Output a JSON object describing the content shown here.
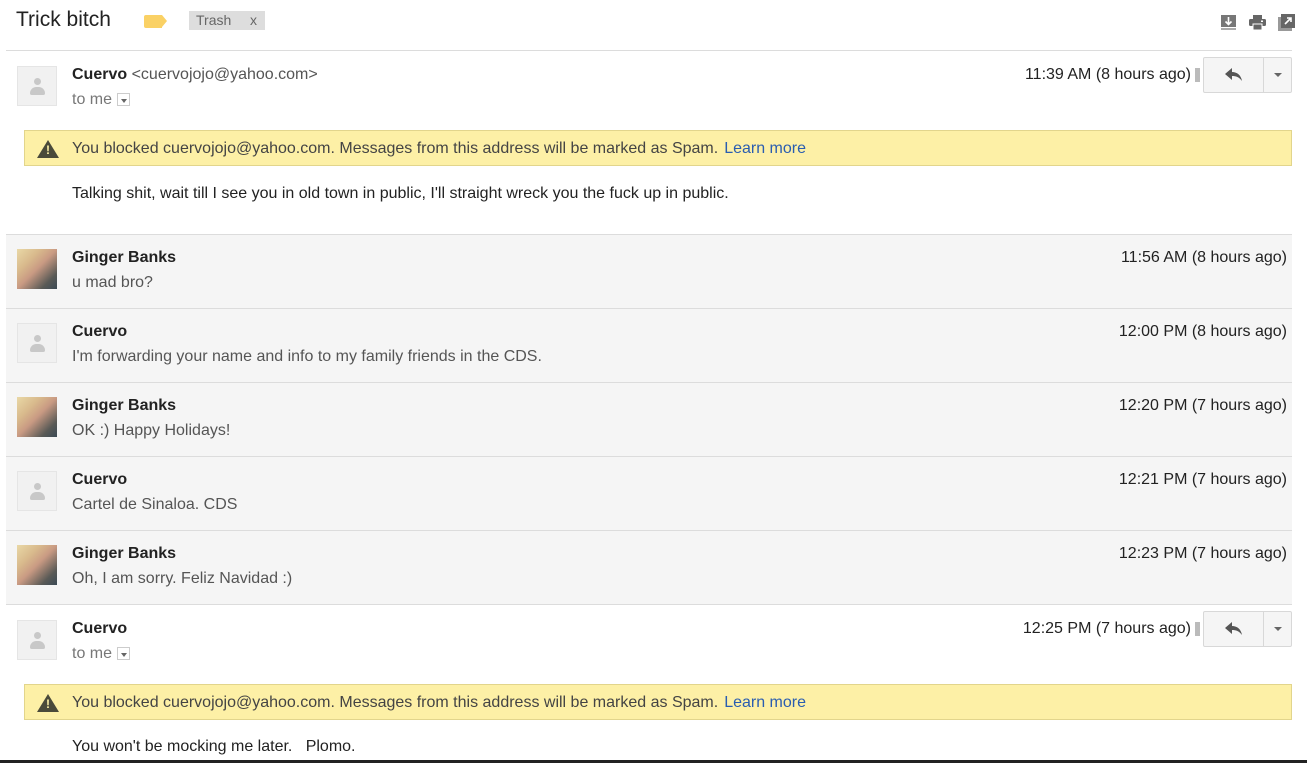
{
  "subject": "Trick bitch",
  "label_chip": {
    "name": "Trash",
    "remove": "x"
  },
  "toolbar_icons": [
    "download-icon",
    "print-icon",
    "new-window-icon"
  ],
  "first_message": {
    "sender": "Cuervo",
    "email": "<cuervojojo@yahoo.com>",
    "to": "to me",
    "time": "11:39 AM (8 hours ago)",
    "banner_text": "You blocked cuervojojo@yahoo.com. Messages from this address will be marked as Spam.",
    "banner_link": "Learn more",
    "body": "Talking shit, wait till I see you in old town in public, I'll straight wreck you the fuck up in public."
  },
  "collapsed_messages": [
    {
      "sender": "Ginger Banks",
      "snippet": "u mad bro?",
      "time": "11:56 AM (8 hours ago)",
      "avatar": "photo"
    },
    {
      "sender": "Cuervo",
      "snippet": "I'm forwarding your name and info to my family friends in the CDS.",
      "time": "12:00 PM (8 hours ago)",
      "avatar": "default"
    },
    {
      "sender": "Ginger Banks",
      "snippet": "OK :) Happy Holidays!",
      "time": "12:20 PM (7 hours ago)",
      "avatar": "photo"
    },
    {
      "sender": "Cuervo",
      "snippet": "Cartel de Sinaloa. CDS",
      "time": "12:21 PM (7 hours ago)",
      "avatar": "default"
    },
    {
      "sender": "Ginger Banks",
      "snippet": "Oh, I am sorry. Feliz Navidad :)",
      "time": "12:23 PM (7 hours ago)",
      "avatar": "photo"
    }
  ],
  "last_message": {
    "sender": "Cuervo",
    "to": "to me",
    "time": "12:25 PM (7 hours ago)",
    "banner_text": "You blocked cuervojojo@yahoo.com. Messages from this address will be marked as Spam.",
    "banner_link": "Learn more",
    "body": "You won't be mocking me later.   Plomo."
  }
}
